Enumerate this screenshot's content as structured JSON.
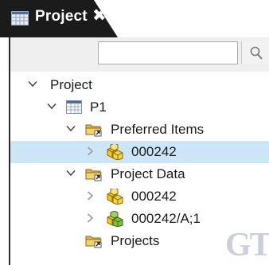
{
  "tab": {
    "title": "Project",
    "close_glyph": "✖",
    "icon": "project-grid-icon"
  },
  "search": {
    "value": "",
    "placeholder": "",
    "button_icon": "search-icon"
  },
  "tree": {
    "items": [
      {
        "label": "Project",
        "expander": "expanded",
        "icon": "none"
      },
      {
        "label": "P1",
        "expander": "expanded",
        "icon": "project-grid-icon"
      },
      {
        "label": "Preferred Items",
        "expander": "expanded",
        "icon": "folder-link-icon"
      },
      {
        "label": "000242",
        "expander": "collapsed",
        "icon": "item-cubes-icon",
        "selected": true
      },
      {
        "label": "Project Data",
        "expander": "expanded",
        "icon": "folder-link-icon"
      },
      {
        "label": "000242",
        "expander": "collapsed",
        "icon": "item-cubes-icon"
      },
      {
        "label": "000242/A;1",
        "expander": "collapsed",
        "icon": "revision-cubes-icon"
      },
      {
        "label": "Projects",
        "expander": "none",
        "icon": "folder-link-icon"
      }
    ]
  },
  "watermark": {
    "text": "GT"
  },
  "colors": {
    "tab_bg": "#1b1b1b",
    "selection": "#cce6f8",
    "folder_yellow": "#f2c94c",
    "cube_yellow": "#f5c518",
    "cube_green": "#7cc242"
  }
}
